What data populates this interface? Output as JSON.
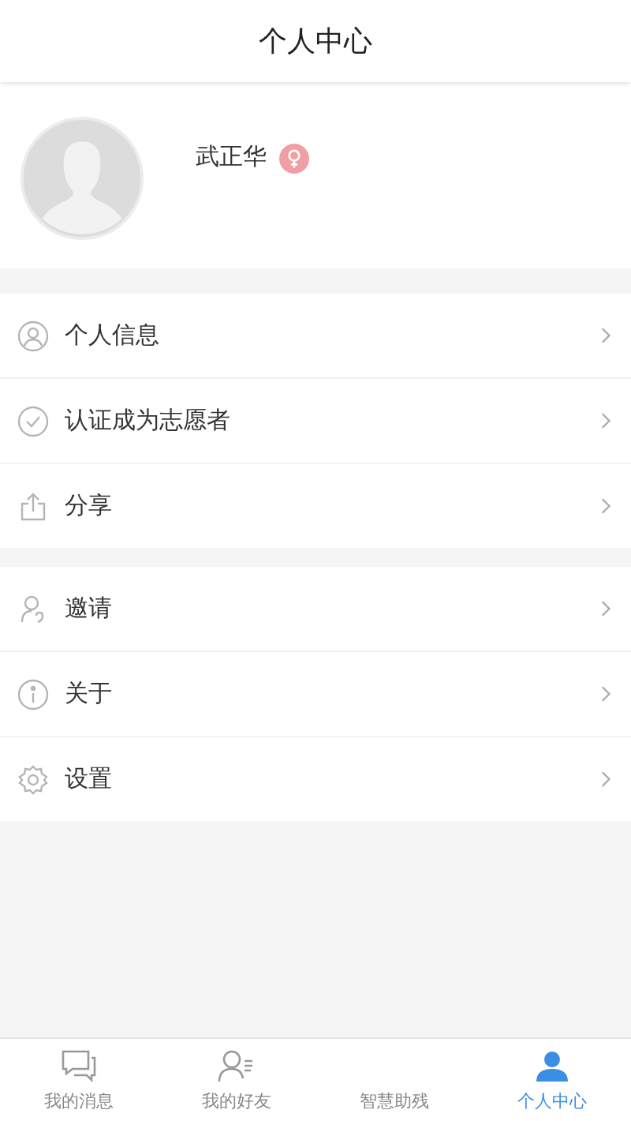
{
  "header": {
    "title": "个人中心"
  },
  "profile": {
    "name": "武正华",
    "kind": "female"
  },
  "menu_groups": [
    [
      {
        "label": "个人信息"
      },
      {
        "label": "认证成为志愿者"
      },
      {
        "label": "分享"
      }
    ],
    [
      {
        "label": "邀请"
      },
      {
        "label": "关于"
      },
      {
        "label": "设置"
      }
    ]
  ],
  "tab_bar": [
    {
      "label": "我的消息",
      "selected": false
    },
    {
      "label": "我的好友",
      "selected": false
    },
    {
      "label": "智慧助残",
      "selected": false
    },
    {
      "label": "个人中心",
      "selected": true
    }
  ]
}
